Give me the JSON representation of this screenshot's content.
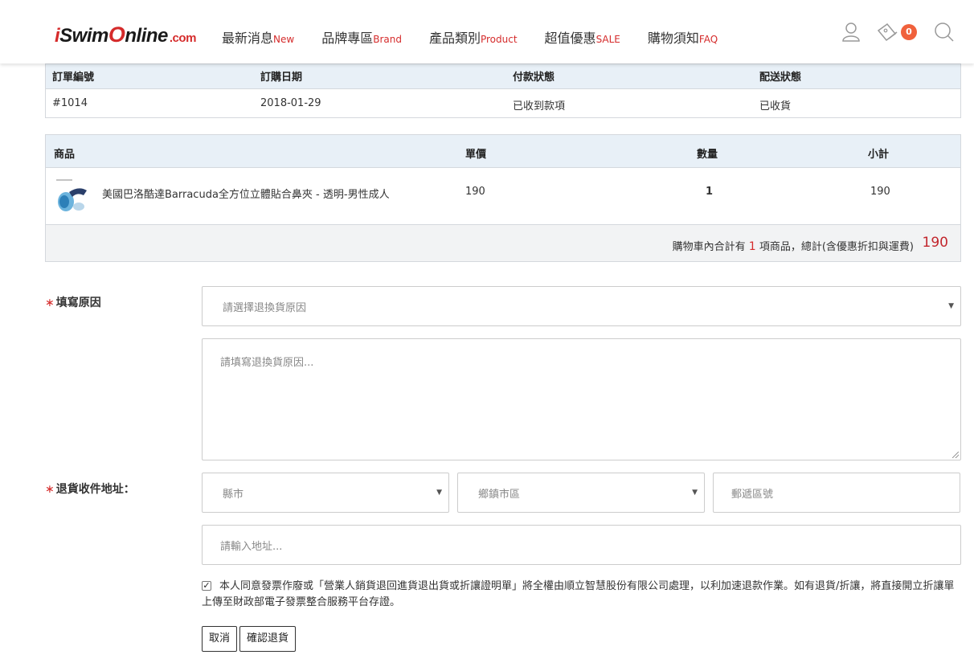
{
  "header": {
    "logo": {
      "i": "i",
      "swim": "Swim",
      "o": "O",
      "nline": "nline",
      "dotcom": ".com"
    },
    "nav": [
      {
        "label": "最新消息",
        "en": "New"
      },
      {
        "label": "品牌專區",
        "en": "Brand"
      },
      {
        "label": "產品類別",
        "en": "Product"
      },
      {
        "label": "超值優惠",
        "en": "SALE"
      },
      {
        "label": "購物須知",
        "en": "FAQ"
      }
    ],
    "cart_count": "0",
    "icons": [
      "user-icon",
      "cart-icon",
      "search-icon"
    ]
  },
  "order_table": {
    "headers": [
      "訂單編號",
      "訂購日期",
      "付款狀態",
      "配送狀態"
    ],
    "row": [
      "#1014",
      "2018-01-29",
      "已收到款項",
      "已收貨"
    ]
  },
  "product_table": {
    "headers": [
      "商品",
      "單價",
      "數量",
      "小計"
    ],
    "items": [
      {
        "name": "美國巴洛酷達Barracuda全方位立體貼合鼻夾 - 透明-男性成人",
        "price": "190",
        "qty": "1",
        "subtotal": "190"
      }
    ],
    "summary_prefix": "購物車內合計有",
    "summary_count": "1",
    "summary_suffix": "項商品，總計(含優惠折扣與運費)",
    "total": "190"
  },
  "form": {
    "reason_label": "填寫原因",
    "reason_select": "請選擇退換貨原因",
    "reason_textarea": "請填寫退換貨原因...",
    "address_label": "退貨收件地址：",
    "county_select": "縣市",
    "district_select": "鄉鎮市區",
    "zip_placeholder": "郵遞區號",
    "address_placeholder": "請輸入地址...",
    "agree_text": "本人同意發票作廢或「營業人銷貨退回進貨退出貨或折讓證明單」將全權由順立智慧股份有限公司處理，以利加速退款作業。如有退貨/折讓，將直接開立折讓單上傳至財政部電子發票整合服務平台存證。",
    "cancel_label": "取消",
    "confirm_label": "確認退貨"
  },
  "colors": {
    "accent": "#d52b2b",
    "table_header": "#e8f0f7",
    "badge": "#f0613c"
  }
}
